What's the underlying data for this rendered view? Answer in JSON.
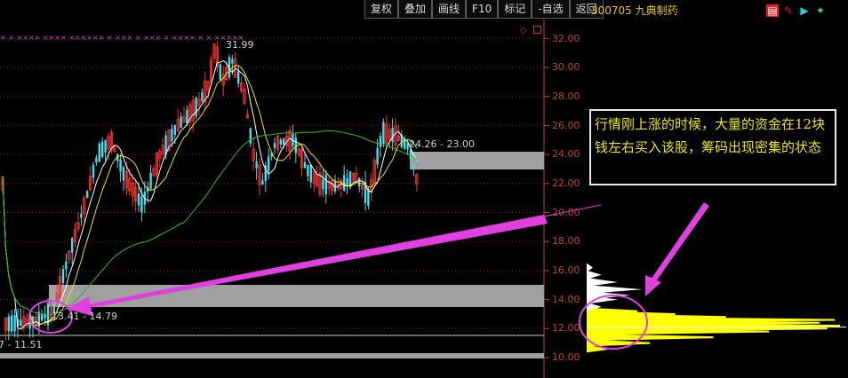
{
  "toolbar": {
    "buttons": [
      "复权",
      "叠加",
      "画线",
      "F10",
      "标记",
      "-自选",
      "返回"
    ]
  },
  "stock": {
    "code_name": "300705 九典制药"
  },
  "price_axis": [
    "32.00",
    "30.00",
    "28.00",
    "26.00",
    "24.00",
    "22.00",
    "20.00",
    "18.00",
    "16.00",
    "14.00",
    "12.00",
    "10.00"
  ],
  "labels": {
    "high": "31.99",
    "range_mid": "24.26 - 23.00",
    "range_low": "13.41 - 14.79",
    "range_bottom": "7 - 11.51"
  },
  "annotation": {
    "text": "行情刚上涨的时候，大量的资金在12块钱左右买入该股，筹码出现密集的状态"
  },
  "markers": {
    "row": "× ×      ××××  ××××  ××××××  ×       ×××   × ×××  ×  ××××  ×                                 ×    ×××××"
  },
  "icons": [
    "chart-icon",
    "pen-icon",
    "play-icon",
    "star-icon"
  ],
  "colors": {
    "up": "#ff3030",
    "down": "#40e0f0",
    "ma_short": "#ffffff",
    "ma_mid": "#e8e800",
    "ma_long": "#20c020",
    "arrow": "#e040e0",
    "chip": "#ffff00",
    "band": "#a0a0a0"
  }
}
